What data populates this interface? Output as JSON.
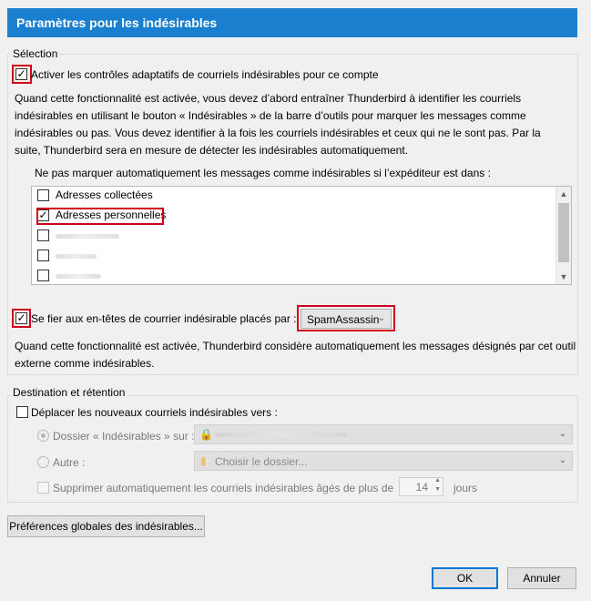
{
  "title": "Paramètres pour les indésirables",
  "selection": {
    "legend": "Sélection",
    "adaptive_checkbox": {
      "label": "Activer les contrôles adaptatifs de courriels indésirables pour ce compte",
      "checked": true
    },
    "description": "Quand cette fonctionnalité est activée, vous devez d’abord entraîner Thunderbird à identifier les courriels indésirables en utilisant le bouton « Indésirables » de la barre d’outils pour marquer les messages comme indésirables ou pas. Vous devez identifier à la fois les courriels indésirables et ceux qui ne le sont pas. Par la suite, Thunderbird sera en mesure de détecter les indésirables automatiquement.",
    "whitelist_label": "Ne pas marquer automatiquement les messages comme indésirables si l’expéditeur est dans :",
    "whitelist_items": [
      {
        "label": "Adresses collectées",
        "checked": false
      },
      {
        "label": "Adresses personnelles",
        "checked": true
      },
      {
        "label": "",
        "checked": false
      },
      {
        "label": "",
        "checked": false
      },
      {
        "label": "",
        "checked": false
      }
    ],
    "trust_headers_checkbox": {
      "label": "Se fier aux en-têtes de courrier indésirable placés par :",
      "checked": true
    },
    "trust_headers_select": "SpamAssassin",
    "trust_description": "Quand cette fonctionnalité est activée, Thunderbird considère automatiquement les messages désignés par cet outil externe comme indésirables."
  },
  "destination": {
    "legend": "Destination et rétention",
    "move_checkbox": {
      "label": "Déplacer les nouveaux courriels indésirables vers :",
      "checked": false
    },
    "folder_radio_label": "Dossier « Indésirables » sur :",
    "other_radio_label": "Autre :",
    "other_select": "Choisir le dossier...",
    "delete_checkbox": {
      "label": "Supprimer automatiquement les courriels indésirables âgés de plus de",
      "checked": false
    },
    "days_value": "14",
    "days_unit": "jours"
  },
  "buttons": {
    "global_prefs": "Préférences globales des indésirables...",
    "ok": "OK",
    "cancel": "Annuler"
  }
}
